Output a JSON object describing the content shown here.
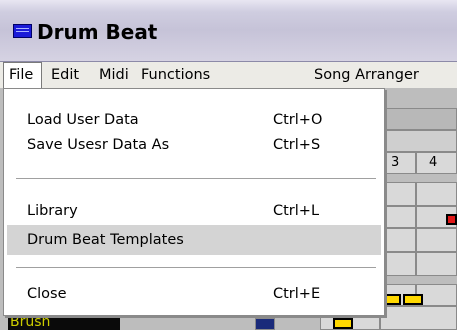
{
  "window": {
    "title": "Drum Beat",
    "app_icon": "app-icon"
  },
  "menubar": {
    "items": [
      {
        "label": "File"
      },
      {
        "label": "Edit"
      },
      {
        "label": "Midi"
      },
      {
        "label": "Functions"
      },
      {
        "label": "Song Arranger"
      }
    ],
    "active_item": "File"
  },
  "file_menu": {
    "items": [
      {
        "label": "Load User Data",
        "shortcut": "Ctrl+O"
      },
      {
        "label": "Save Usesr Data As",
        "shortcut": "Ctrl+S"
      },
      {
        "label": "Library",
        "shortcut": "Ctrl+L"
      },
      {
        "label": "Drum Beat Templates",
        "shortcut": ""
      },
      {
        "label": "Close",
        "shortcut": "Ctrl+E"
      }
    ],
    "highlighted_item": "Drum Beat Templates"
  },
  "background": {
    "beat_numbers": [
      "3",
      "4"
    ],
    "track_label": "Brush",
    "colors": {
      "note_yellow": "#ffd800",
      "note_red": "#e01818",
      "track_label_bg": "#0a0a0a",
      "track_label_text": "#cccc00"
    }
  }
}
